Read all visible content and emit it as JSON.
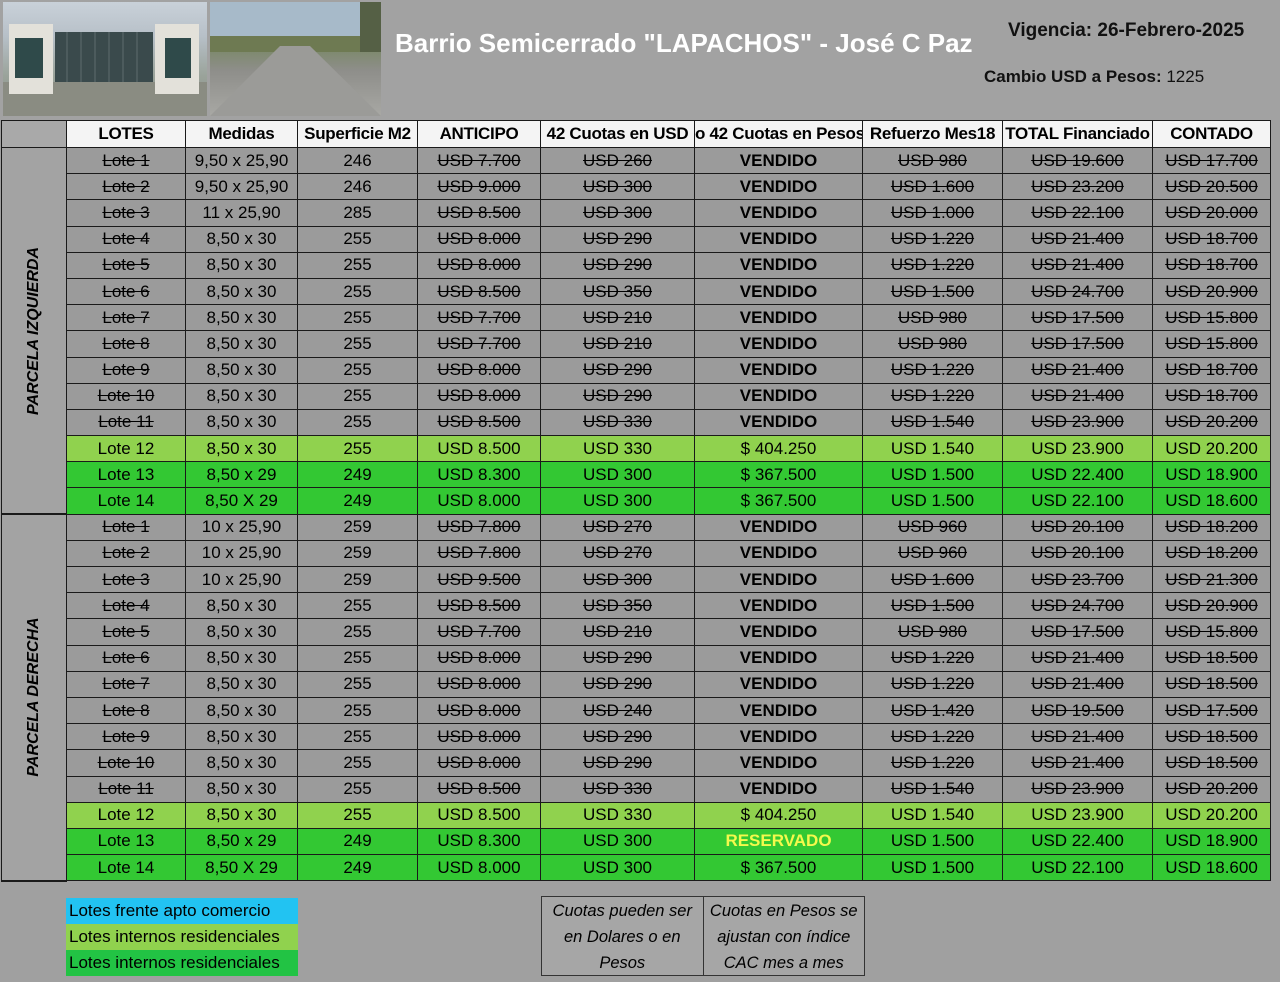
{
  "header": {
    "title": "Barrio Semicerrado \"LAPACHOS\" - José C Paz",
    "vigencia": "Vigencia: 26-Febrero-2025",
    "cambio_label": "Cambio USD a Pesos:",
    "cambio_value": "1225"
  },
  "columns": [
    "LOTES",
    "Medidas",
    "Superficie M2",
    "ANTICIPO",
    "42 Cuotas en USD",
    "o 42 Cuotas en Pesos",
    "Refuerzo Mes18",
    "TOTAL Financiado",
    "CONTADO"
  ],
  "parcels": [
    {
      "label": "PARCELA IZQUIERDA",
      "rows": [
        {
          "lote": "Lote 1",
          "medidas": "9,50 x 25,90",
          "sup": "246",
          "anticipo": "USD 7.700",
          "cuotas_usd": "USD 260",
          "cuotas_pesos": "VENDIDO",
          "refuerzo": "USD 980",
          "total": "USD 19.600",
          "contado": "USD 17.700",
          "status": "sold"
        },
        {
          "lote": "Lote 2",
          "medidas": "9,50 x 25,90",
          "sup": "246",
          "anticipo": "USD 9.000",
          "cuotas_usd": "USD 300",
          "cuotas_pesos": "VENDIDO",
          "refuerzo": "USD 1.600",
          "total": "USD 23.200",
          "contado": "USD 20.500",
          "status": "sold"
        },
        {
          "lote": "Lote 3",
          "medidas": "11 x 25,90",
          "sup": "285",
          "anticipo": "USD 8.500",
          "cuotas_usd": "USD 300",
          "cuotas_pesos": "VENDIDO",
          "refuerzo": "USD 1.000",
          "total": "USD 22.100",
          "contado": "USD 20.000",
          "status": "sold"
        },
        {
          "lote": "Lote 4",
          "medidas": "8,50 x 30",
          "sup": "255",
          "anticipo": "USD 8.000",
          "cuotas_usd": "USD 290",
          "cuotas_pesos": "VENDIDO",
          "refuerzo": "USD 1.220",
          "total": "USD 21.400",
          "contado": "USD 18.700",
          "status": "sold"
        },
        {
          "lote": "Lote 5",
          "medidas": "8,50 x 30",
          "sup": "255",
          "anticipo": "USD 8.000",
          "cuotas_usd": "USD 290",
          "cuotas_pesos": "VENDIDO",
          "refuerzo": "USD 1.220",
          "total": "USD 21.400",
          "contado": "USD 18.700",
          "status": "sold"
        },
        {
          "lote": "Lote 6",
          "medidas": "8,50 x 30",
          "sup": "255",
          "anticipo": "USD 8.500",
          "cuotas_usd": "USD 350",
          "cuotas_pesos": "VENDIDO",
          "refuerzo": "USD 1.500",
          "total": "USD 24.700",
          "contado": "USD 20.900",
          "status": "sold"
        },
        {
          "lote": "Lote 7",
          "medidas": "8,50 x 30",
          "sup": "255",
          "anticipo": "USD 7.700",
          "cuotas_usd": "USD 210",
          "cuotas_pesos": "VENDIDO",
          "refuerzo": "USD 980",
          "total": "USD 17.500",
          "contado": "USD 15.800",
          "status": "sold"
        },
        {
          "lote": "Lote 8",
          "medidas": "8,50 x 30",
          "sup": "255",
          "anticipo": "USD 7.700",
          "cuotas_usd": "USD 210",
          "cuotas_pesos": "VENDIDO",
          "refuerzo": "USD 980",
          "total": "USD 17.500",
          "contado": "USD 15.800",
          "status": "sold"
        },
        {
          "lote": "Lote 9",
          "medidas": "8,50 x 30",
          "sup": "255",
          "anticipo": "USD 8.000",
          "cuotas_usd": "USD 290",
          "cuotas_pesos": "VENDIDO",
          "refuerzo": "USD 1.220",
          "total": "USD 21.400",
          "contado": "USD 18.700",
          "status": "sold"
        },
        {
          "lote": "Lote 10",
          "medidas": "8,50 x 30",
          "sup": "255",
          "anticipo": "USD 8.000",
          "cuotas_usd": "USD 290",
          "cuotas_pesos": "VENDIDO",
          "refuerzo": "USD 1.220",
          "total": "USD 21.400",
          "contado": "USD 18.700",
          "status": "sold"
        },
        {
          "lote": "Lote 11",
          "medidas": "8,50 x 30",
          "sup": "255",
          "anticipo": "USD 8.500",
          "cuotas_usd": "USD 330",
          "cuotas_pesos": "VENDIDO",
          "refuerzo": "USD 1.540",
          "total": "USD 23.900",
          "contado": "USD 20.200",
          "status": "sold"
        },
        {
          "lote": "Lote 12",
          "medidas": "8,50 x 30",
          "sup": "255",
          "anticipo": "USD 8.500",
          "cuotas_usd": "USD 330",
          "cuotas_pesos": "$ 404.250",
          "refuerzo": "USD 1.540",
          "total": "USD 23.900",
          "contado": "USD 20.200",
          "status": "lightgreen"
        },
        {
          "lote": "Lote 13",
          "medidas": "8,50 x 29",
          "sup": "249",
          "anticipo": "USD 8.300",
          "cuotas_usd": "USD 300",
          "cuotas_pesos": "$ 367.500",
          "refuerzo": "USD 1.500",
          "total": "USD 22.400",
          "contado": "USD 18.900",
          "status": "green"
        },
        {
          "lote": "Lote 14",
          "medidas": "8,50 X 29",
          "sup": "249",
          "anticipo": "USD 8.000",
          "cuotas_usd": "USD 300",
          "cuotas_pesos": "$ 367.500",
          "refuerzo": "USD 1.500",
          "total": "USD 22.100",
          "contado": "USD 18.600",
          "status": "green"
        }
      ]
    },
    {
      "label": "PARCELA DERECHA",
      "rows": [
        {
          "lote": "Lote 1",
          "medidas": "10 x 25,90",
          "sup": "259",
          "anticipo": "USD 7.800",
          "cuotas_usd": "USD 270",
          "cuotas_pesos": "VENDIDO",
          "refuerzo": "USD 960",
          "total": "USD 20.100",
          "contado": "USD 18.200",
          "status": "sold"
        },
        {
          "lote": "Lote 2",
          "medidas": "10 x 25,90",
          "sup": "259",
          "anticipo": "USD 7.800",
          "cuotas_usd": "USD 270",
          "cuotas_pesos": "VENDIDO",
          "refuerzo": "USD 960",
          "total": "USD 20.100",
          "contado": "USD 18.200",
          "status": "sold"
        },
        {
          "lote": "Lote 3",
          "medidas": "10 x 25,90",
          "sup": "259",
          "anticipo": "USD 9.500",
          "cuotas_usd": "USD 300",
          "cuotas_pesos": "VENDIDO",
          "refuerzo": "USD 1.600",
          "total": "USD 23.700",
          "contado": "USD 21.300",
          "status": "sold"
        },
        {
          "lote": "Lote 4",
          "medidas": "8,50 x 30",
          "sup": "255",
          "anticipo": "USD 8.500",
          "cuotas_usd": "USD 350",
          "cuotas_pesos": "VENDIDO",
          "refuerzo": "USD 1.500",
          "total": "USD 24.700",
          "contado": "USD 20.900",
          "status": "sold"
        },
        {
          "lote": "Lote 5",
          "medidas": "8,50 x 30",
          "sup": "255",
          "anticipo": "USD 7.700",
          "cuotas_usd": "USD 210",
          "cuotas_pesos": "VENDIDO",
          "refuerzo": "USD 980",
          "total": "USD 17.500",
          "contado": "USD 15.800",
          "status": "sold"
        },
        {
          "lote": "Lote 6",
          "medidas": "8,50 x 30",
          "sup": "255",
          "anticipo": "USD 8.000",
          "cuotas_usd": "USD 290",
          "cuotas_pesos": "VENDIDO",
          "refuerzo": "USD 1.220",
          "total": "USD 21.400",
          "contado": "USD 18.500",
          "status": "sold"
        },
        {
          "lote": "Lote 7",
          "medidas": "8,50 x 30",
          "sup": "255",
          "anticipo": "USD 8.000",
          "cuotas_usd": "USD 290",
          "cuotas_pesos": "VENDIDO",
          "refuerzo": "USD 1.220",
          "total": "USD 21.400",
          "contado": "USD 18.500",
          "status": "sold"
        },
        {
          "lote": "Lote 8",
          "medidas": "8,50 x 30",
          "sup": "255",
          "anticipo": "USD 8.000",
          "cuotas_usd": "USD 240",
          "cuotas_pesos": "VENDIDO",
          "refuerzo": "USD 1.420",
          "total": "USD 19.500",
          "contado": "USD 17.500",
          "status": "sold"
        },
        {
          "lote": "Lote 9",
          "medidas": "8,50 x 30",
          "sup": "255",
          "anticipo": "USD 8.000",
          "cuotas_usd": "USD 290",
          "cuotas_pesos": "VENDIDO",
          "refuerzo": "USD 1.220",
          "total": "USD 21.400",
          "contado": "USD 18.500",
          "status": "sold"
        },
        {
          "lote": "Lote 10",
          "medidas": "8,50 x 30",
          "sup": "255",
          "anticipo": "USD 8.000",
          "cuotas_usd": "USD 290",
          "cuotas_pesos": "VENDIDO",
          "refuerzo": "USD 1.220",
          "total": "USD 21.400",
          "contado": "USD 18.500",
          "status": "sold"
        },
        {
          "lote": "Lote 11",
          "medidas": "8,50 x 30",
          "sup": "255",
          "anticipo": "USD 8.500",
          "cuotas_usd": "USD 330",
          "cuotas_pesos": "VENDIDO",
          "refuerzo": "USD 1.540",
          "total": "USD 23.900",
          "contado": "USD 20.200",
          "status": "sold"
        },
        {
          "lote": "Lote 12",
          "medidas": "8,50 x 30",
          "sup": "255",
          "anticipo": "USD 8.500",
          "cuotas_usd": "USD 330",
          "cuotas_pesos": "$ 404.250",
          "refuerzo": "USD 1.540",
          "total": "USD 23.900",
          "contado": "USD 20.200",
          "status": "lightgreen"
        },
        {
          "lote": "Lote 13",
          "medidas": "8,50 x 29",
          "sup": "249",
          "anticipo": "USD 8.300",
          "cuotas_usd": "USD 300",
          "cuotas_pesos": "RESERVADO",
          "refuerzo": "USD 1.500",
          "total": "USD 22.400",
          "contado": "USD 18.900",
          "status": "green",
          "reserved": true
        },
        {
          "lote": "Lote 14",
          "medidas": "8,50 X 29",
          "sup": "249",
          "anticipo": "USD 8.000",
          "cuotas_usd": "USD 300",
          "cuotas_pesos": "$ 367.500",
          "refuerzo": "USD 1.500",
          "total": "USD 22.100",
          "contado": "USD 18.600",
          "status": "green"
        }
      ]
    }
  ],
  "legend": [
    {
      "label": "Lotes frente apto comercio",
      "color": "#22c3f2"
    },
    {
      "label": "Lotes internos residenciales",
      "color": "#90d24e"
    },
    {
      "label": "Lotes internos residenciales",
      "color": "#22c344"
    }
  ],
  "notes": [
    "Cuotas pueden ser en Dolares o en Pesos",
    "Cuotas en Pesos se ajustan con índice CAC mes a mes"
  ]
}
